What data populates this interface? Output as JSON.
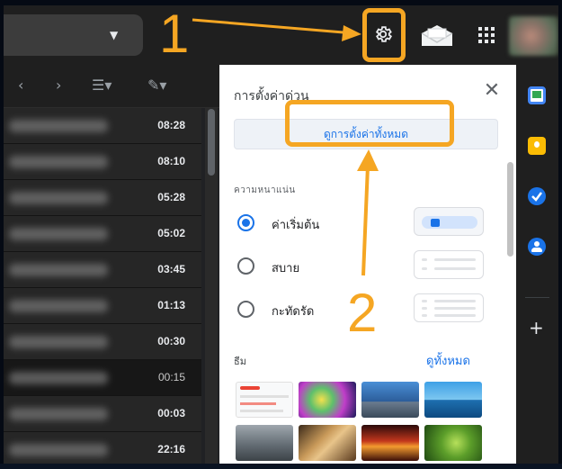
{
  "panel": {
    "title": "การตั้งค่าด่วน",
    "see_all_label": "ดูการตั้งค่าทั้งหมด",
    "density_label": "ความหนาแน่น",
    "density_options": [
      {
        "label": "ค่าเริ่มต้น",
        "selected": true
      },
      {
        "label": "สบาย",
        "selected": false
      },
      {
        "label": "กะทัดรัด",
        "selected": false
      }
    ],
    "theme_label": "ธีม",
    "theme_see_all": "ดูทั้งหมด"
  },
  "mail": {
    "times": [
      "08:28",
      "08:10",
      "05:28",
      "05:02",
      "03:45",
      "01:13",
      "00:30",
      "00:15",
      "00:03",
      "22:16"
    ],
    "read_index": 7
  },
  "annotations": {
    "step1": "1",
    "step2": "2",
    "color": "#f5a623"
  },
  "icons": {
    "settings": "gear-icon",
    "support": "envelope-icon",
    "apps": "apps-grid-icon",
    "close": "close-icon",
    "add": "plus-icon"
  },
  "colors": {
    "accent": "#1a73e8",
    "annotation": "#f5a623",
    "dark_bg": "#202124"
  }
}
